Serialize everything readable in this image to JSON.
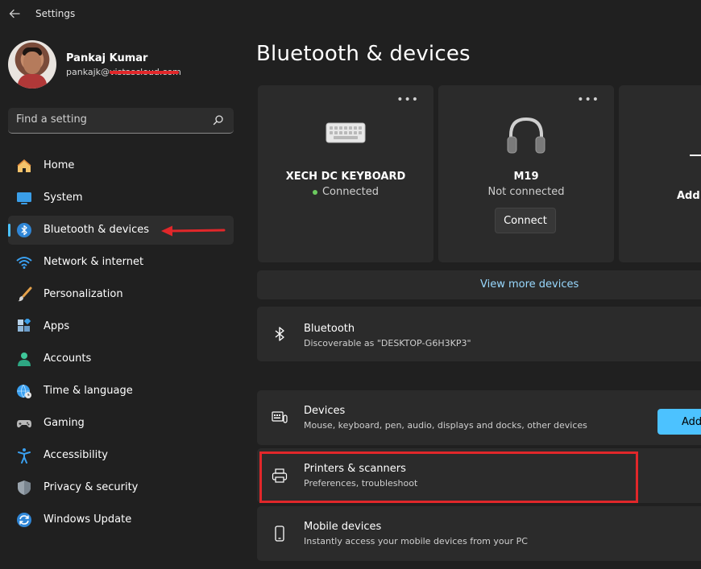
{
  "window": {
    "title": "Settings"
  },
  "user": {
    "name": "Pankaj Kumar",
    "email": "pankajk@vistascloud.com"
  },
  "search": {
    "placeholder": "Find a setting"
  },
  "sidebar": {
    "items": [
      {
        "label": "Home",
        "icon": "home-icon"
      },
      {
        "label": "System",
        "icon": "system-icon"
      },
      {
        "label": "Bluetooth & devices",
        "icon": "bluetooth-icon",
        "active": true
      },
      {
        "label": "Network & internet",
        "icon": "wifi-icon"
      },
      {
        "label": "Personalization",
        "icon": "brush-icon"
      },
      {
        "label": "Apps",
        "icon": "apps-icon"
      },
      {
        "label": "Accounts",
        "icon": "accounts-icon"
      },
      {
        "label": "Time & language",
        "icon": "globe-clock-icon"
      },
      {
        "label": "Gaming",
        "icon": "gamepad-icon"
      },
      {
        "label": "Accessibility",
        "icon": "accessibility-icon"
      },
      {
        "label": "Privacy & security",
        "icon": "shield-icon"
      },
      {
        "label": "Windows Update",
        "icon": "update-icon"
      }
    ]
  },
  "main": {
    "title": "Bluetooth & devices",
    "devices": [
      {
        "name": "XECH DC KEYBOARD",
        "status": "Connected",
        "icon": "keyboard-icon"
      },
      {
        "name": "M19",
        "status": "Not connected",
        "button": "Connect",
        "icon": "headphones-icon"
      }
    ],
    "add_card_label": "Add",
    "view_more": "View more devices",
    "bluetooth": {
      "title": "Bluetooth",
      "subtitle": "Discoverable as \"DESKTOP-G6H3KP3\""
    },
    "rows": [
      {
        "title": "Devices",
        "subtitle": "Mouse, keyboard, pen, audio, displays and docks, other devices",
        "button": "Add",
        "icon": "devices-icon"
      },
      {
        "title": "Printers & scanners",
        "subtitle": "Preferences, troubleshoot",
        "icon": "printer-icon"
      },
      {
        "title": "Mobile devices",
        "subtitle": "Instantly access your mobile devices from your PC",
        "icon": "phone-icon"
      }
    ]
  },
  "colors": {
    "background": "#202020",
    "card": "#2b2b2b",
    "accent": "#4cc2ff",
    "annotation_red": "#e1272a",
    "link": "#99d9ff",
    "status_green": "#6ccb5f"
  }
}
